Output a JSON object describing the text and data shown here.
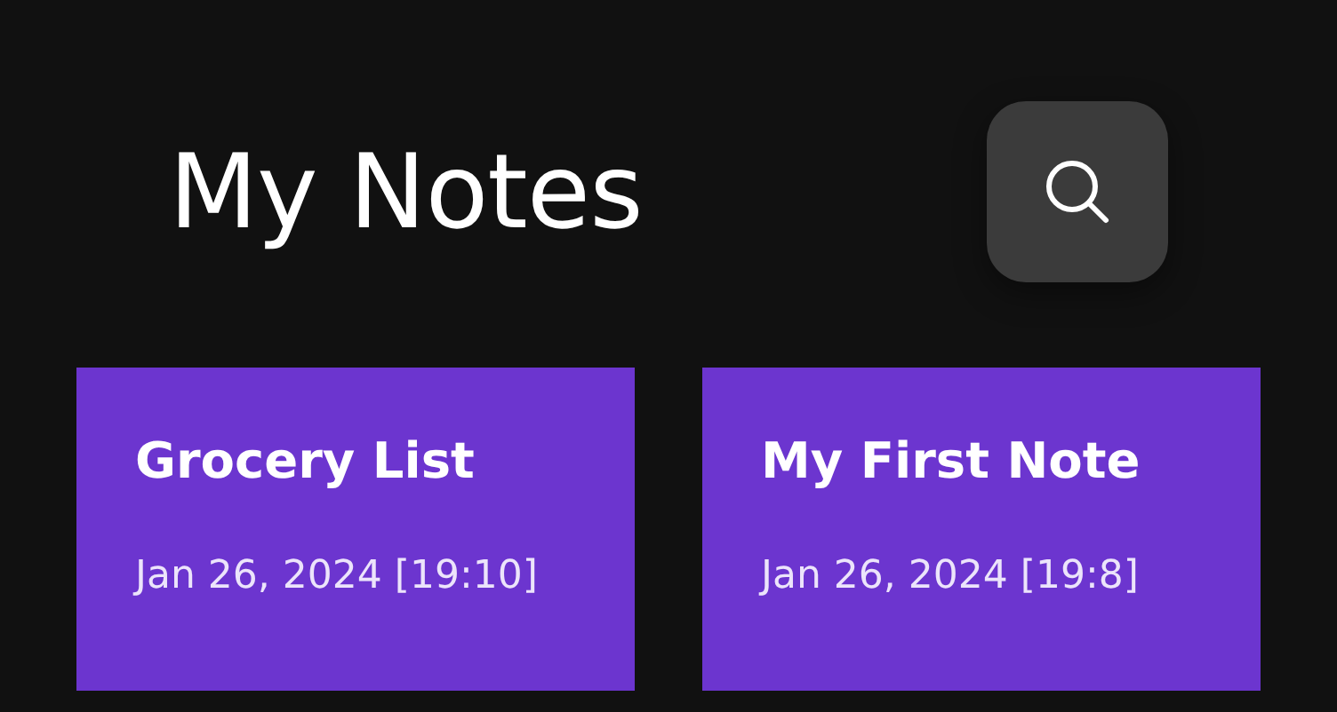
{
  "title": "My Notes",
  "notes": [
    {
      "title": "Grocery List",
      "date": "Jan 26, 2024 [19:10]"
    },
    {
      "title": "My First Note",
      "date": "Jan 26, 2024 [19:8]"
    }
  ]
}
